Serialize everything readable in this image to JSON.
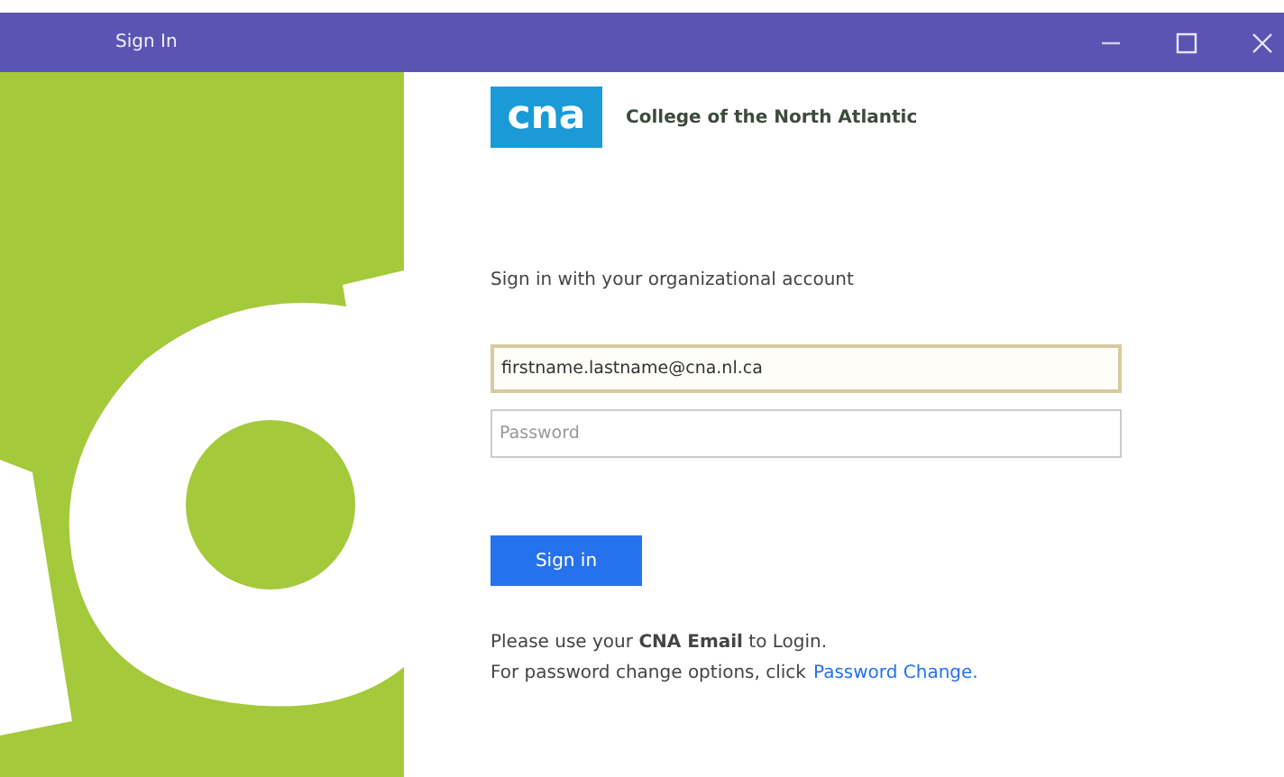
{
  "window": {
    "title": "Sign In"
  },
  "header": {
    "logo_text": "cna",
    "organization": "College of the North Atlantic"
  },
  "form": {
    "prompt": "Sign in with your organizational account",
    "email": {
      "value": "firstname.lastname@cna.nl.ca",
      "focused": true
    },
    "password": {
      "placeholder": "Password",
      "focused": false
    },
    "submit": "Sign in"
  },
  "footer": {
    "line_1": "Please use your **CNA Email** to Login.",
    "line_2": "For password change options, click",
    "link": "Password Change."
  }
}
